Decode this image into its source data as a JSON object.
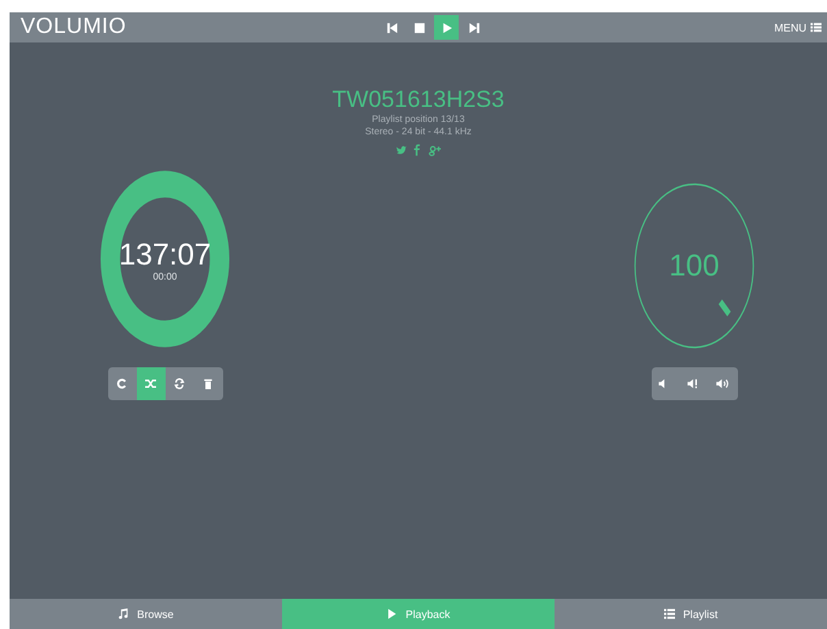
{
  "header": {
    "logo": "VOLUMIO",
    "transport": [
      {
        "kind": "prev",
        "selected": false
      },
      {
        "kind": "stop",
        "selected": false
      },
      {
        "kind": "play",
        "selected": true
      },
      {
        "kind": "next",
        "selected": false
      }
    ],
    "menu": "MENU"
  },
  "track": {
    "title": "TW051613H2S3",
    "position": "Playlist position 13/13",
    "format": "Stereo - 24 bit - 44.1 kHz"
  },
  "seek": {
    "total": "137:07",
    "elapsed": "00:00"
  },
  "queue_controls": [
    {
      "kind": "repeat",
      "selected": false
    },
    {
      "kind": "random",
      "selected": true
    },
    {
      "kind": "single",
      "selected": false
    },
    {
      "kind": "clear",
      "selected": false
    }
  ],
  "volume": {
    "reading": "100"
  },
  "volume_controls": [
    {
      "kind": "mute"
    },
    {
      "kind": "down"
    },
    {
      "kind": "up"
    }
  ],
  "nav": [
    {
      "kind": "browse",
      "label": "Browse",
      "selected": false
    },
    {
      "kind": "playback",
      "label": "Playback",
      "selected": true
    },
    {
      "kind": "playlist",
      "label": "Playlist",
      "selected": false
    }
  ]
}
